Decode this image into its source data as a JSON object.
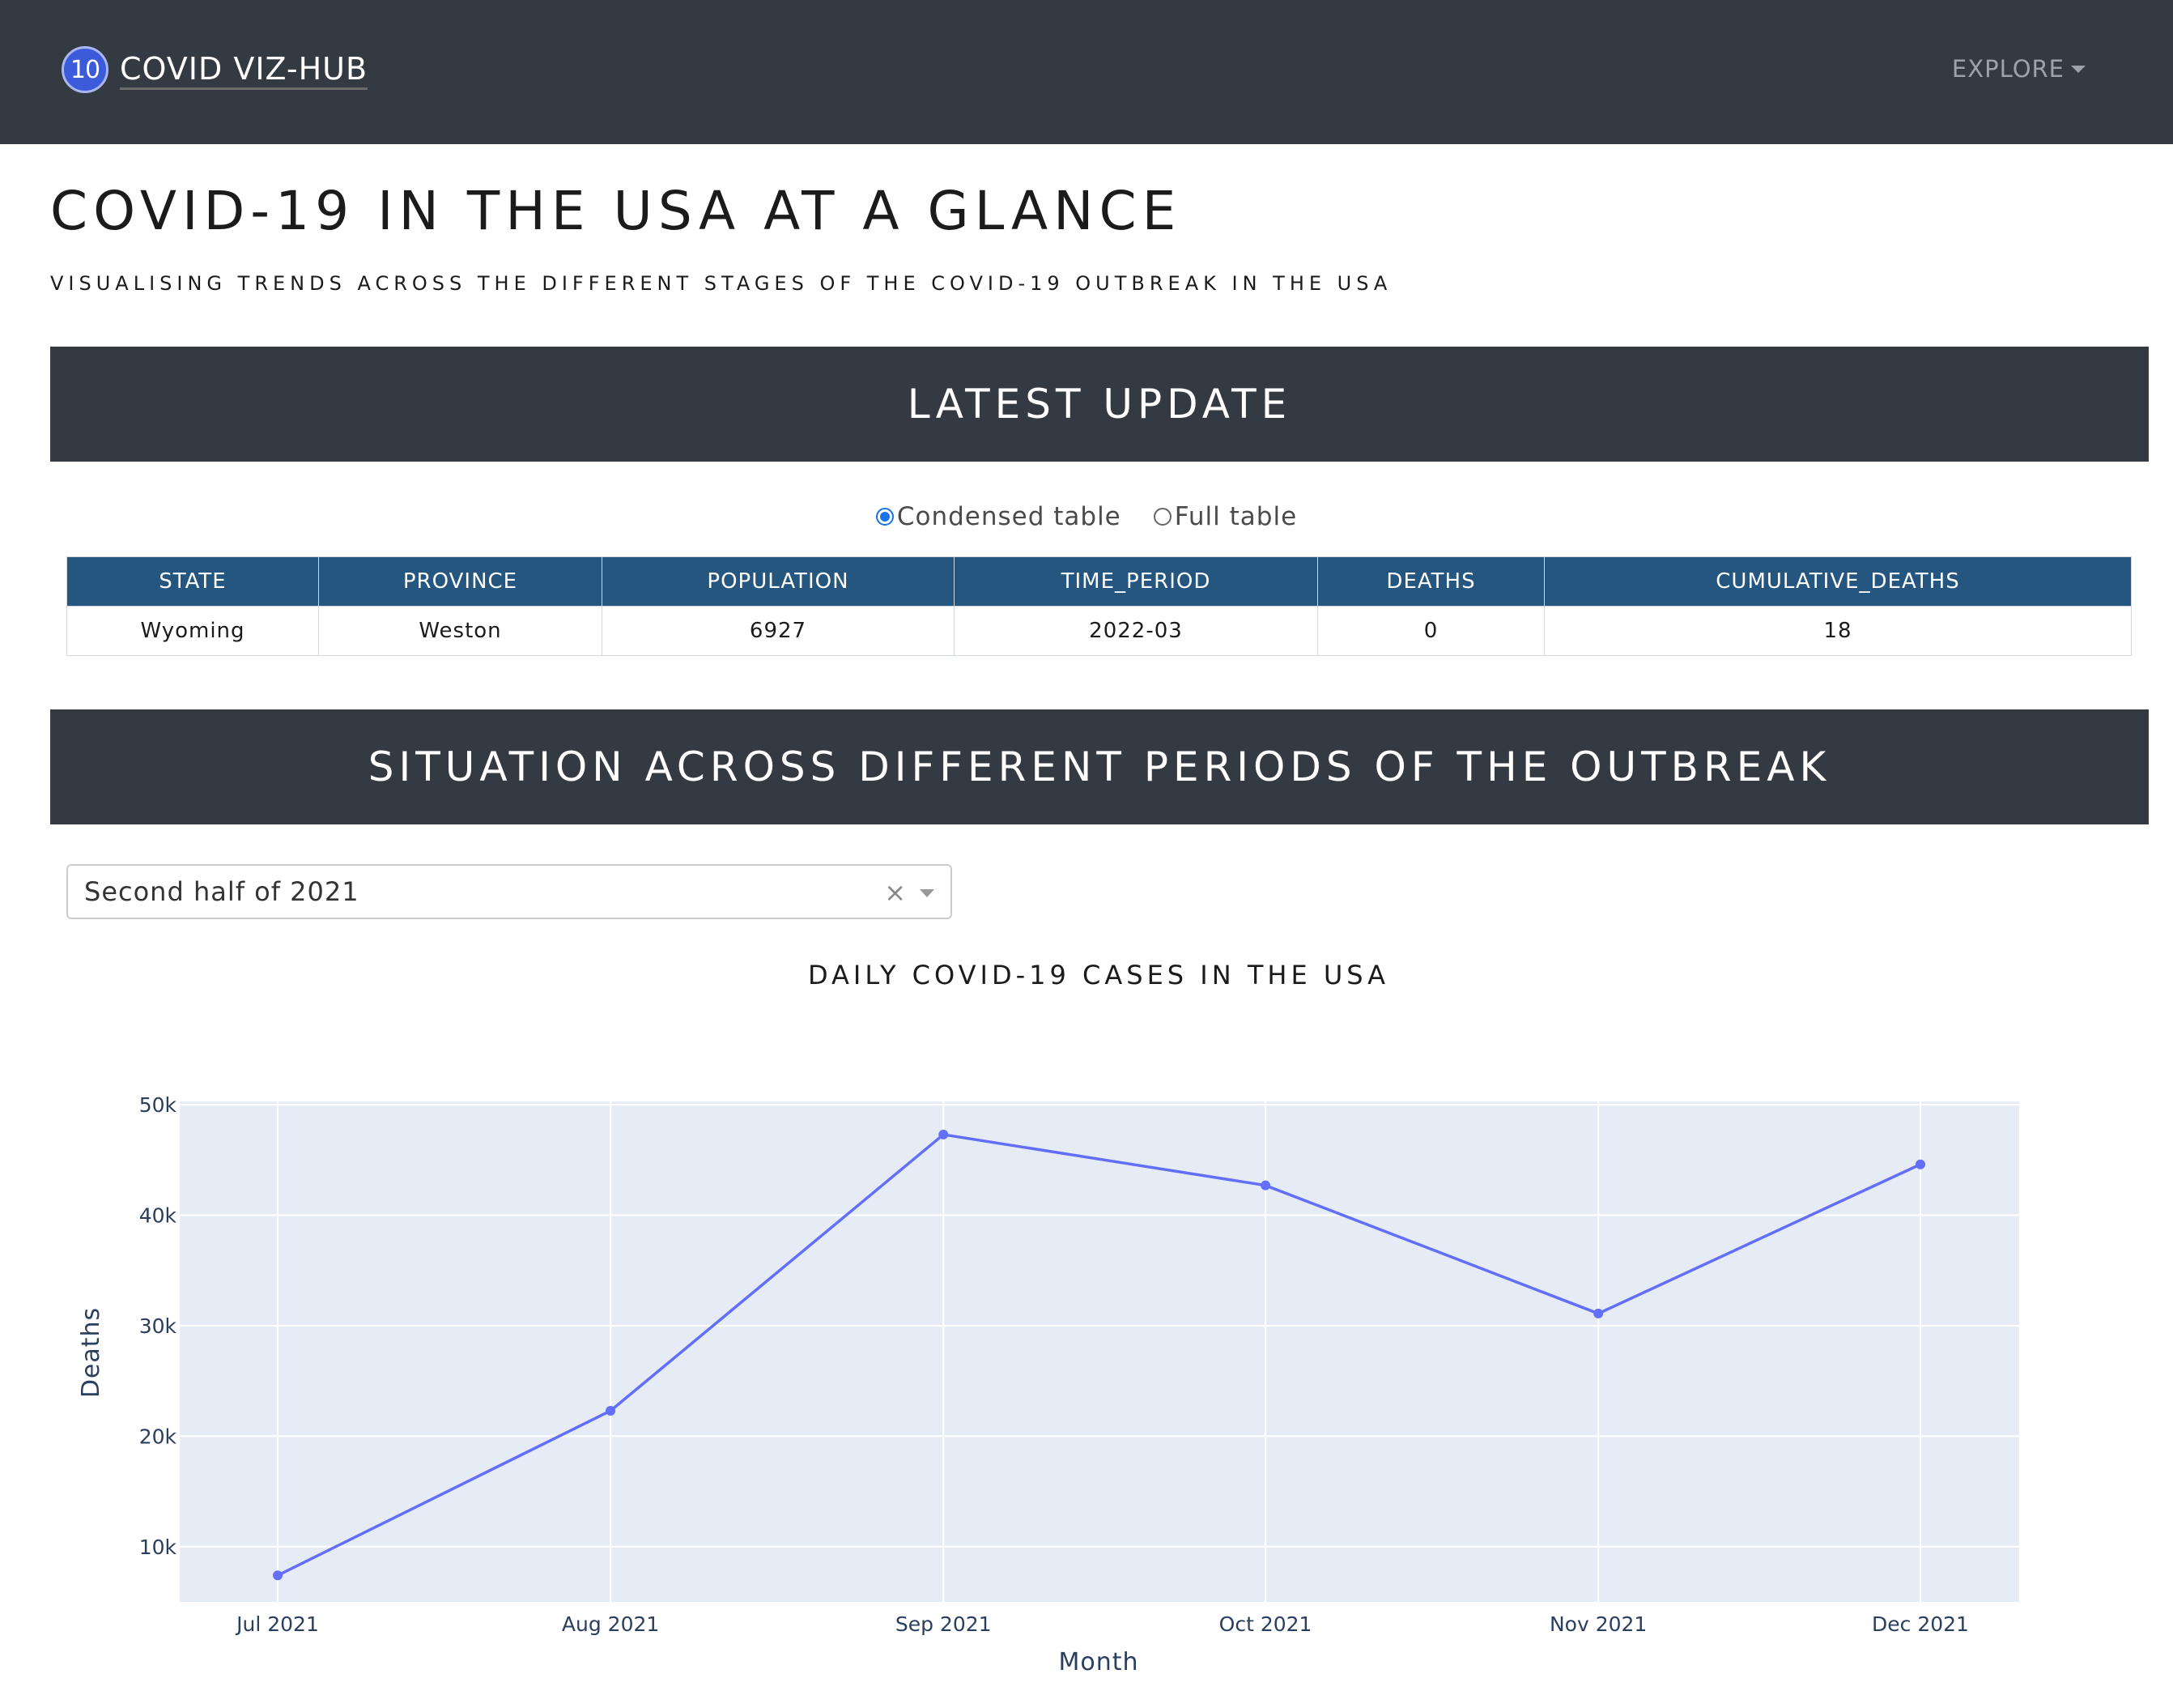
{
  "navbar": {
    "logo_text": "10",
    "brand": "COVID VIZ-HUB",
    "explore_label": "EXPLORE"
  },
  "header": {
    "title": "COVID-19 IN THE USA AT A GLANCE",
    "subtitle": "VISUALISING TRENDS ACROSS THE DIFFERENT STAGES OF THE COVID-19 OUTBREAK IN THE USA"
  },
  "latest": {
    "heading": "LATEST UPDATE",
    "options": [
      "Condensed table",
      "Full table"
    ],
    "selected": "Condensed table",
    "columns": [
      "STATE",
      "PROVINCE",
      "POPULATION",
      "TIME_PERIOD",
      "DEATHS",
      "CUMULATIVE_DEATHS"
    ],
    "row": [
      "Wyoming",
      "Weston",
      "6927",
      "2022-03",
      "0",
      "18"
    ]
  },
  "periods": {
    "heading": "SITUATION ACROSS DIFFERENT PERIODS OF THE OUTBREAK",
    "dropdown_value": "Second half of 2021",
    "clear_symbol": "×"
  },
  "colors": {
    "navbar": "#343a41",
    "table_header": "#245680",
    "line": "#636efa",
    "plot_bg": "#e5ecf6"
  },
  "chart_data": {
    "type": "line",
    "title": "DAILY COVID-19 CASES IN THE USA",
    "xlabel": "Month",
    "ylabel": "Deaths",
    "categories": [
      "Jul 2021",
      "Aug 2021",
      "Sep 2021",
      "Oct 2021",
      "Nov 2021",
      "Dec 2021"
    ],
    "x": [
      "2021-07-01",
      "2021-08-01",
      "2021-09-01",
      "2021-10-01",
      "2021-11-01",
      "2021-12-01"
    ],
    "values": [
      7400,
      22300,
      47300,
      42700,
      31100,
      44600
    ],
    "ylim": [
      5000,
      50300
    ],
    "yticks": [
      10000,
      20000,
      30000,
      40000,
      50000
    ],
    "ytick_labels": [
      "10k",
      "20k",
      "30k",
      "40k",
      "50k"
    ],
    "grid": true
  }
}
